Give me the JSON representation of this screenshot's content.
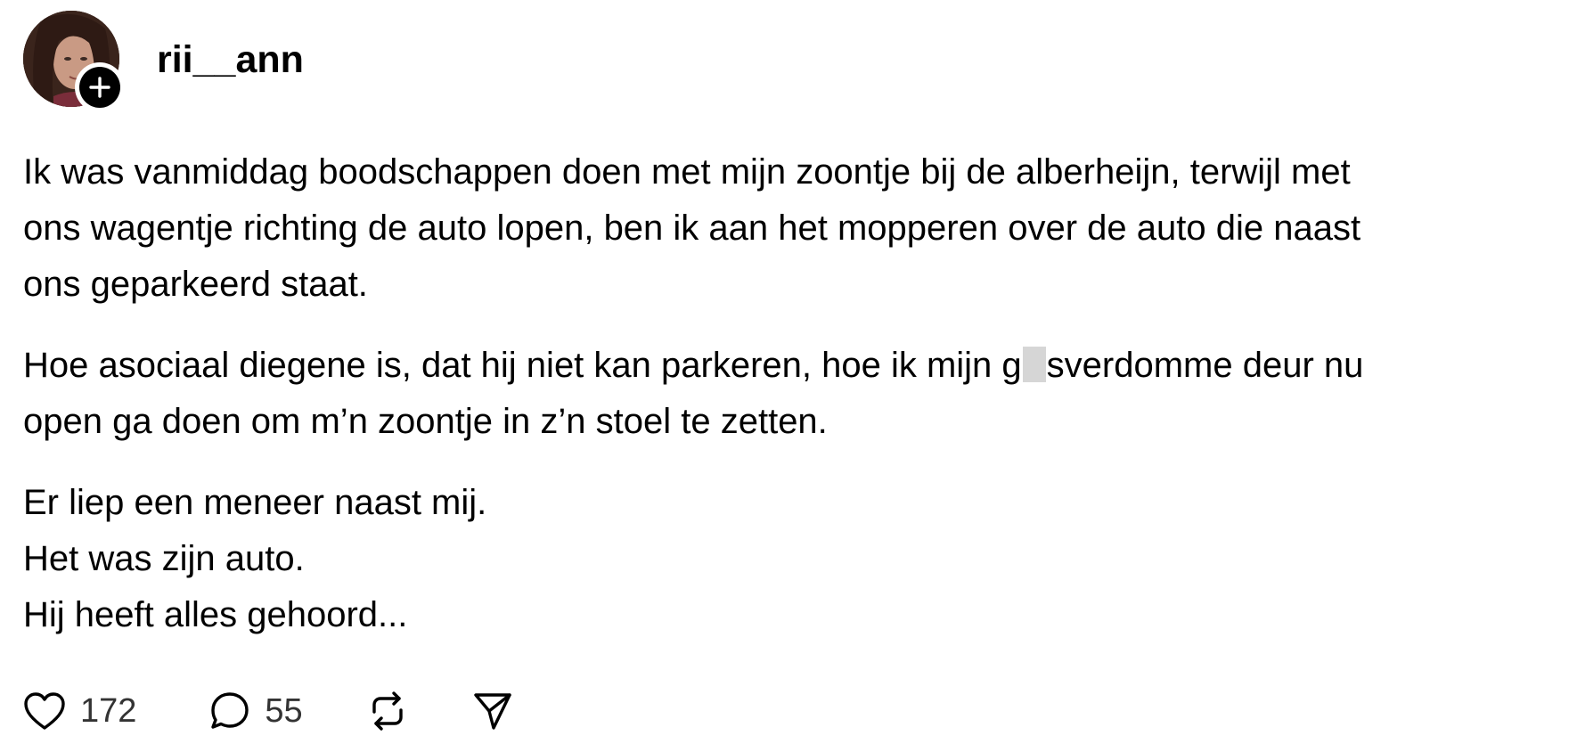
{
  "post": {
    "author": {
      "username": "rii__ann",
      "avatar_icon": "profile-photo",
      "follow_icon": "plus-icon"
    },
    "paragraphs": [
      {
        "text": "Ik was vanmiddag boodschappen doen met mijn zoontje bij de alberheijn, terwijl met\nons wagentje richting de auto lopen, ben ik aan het mopperen over de auto die naast\nons geparkeerd staat."
      },
      {
        "before_censor": "Hoe asociaal diegene is, dat hij niet kan parkeren, hoe ik mijn g",
        "after_censor": "sverdomme deur nu\nopen ga doen om m’n zoontje in z’n stoel te zetten."
      },
      {
        "text": "Er liep een meneer naast mij.\nHet was zijn auto.\nHij heeft alles gehoord..."
      }
    ],
    "actions": {
      "like": {
        "icon": "heart-icon",
        "count": "172"
      },
      "reply": {
        "icon": "comment-bubble-icon",
        "count": "55"
      },
      "repost": {
        "icon": "repost-icon"
      },
      "share": {
        "icon": "send-icon"
      }
    },
    "colors": {
      "text": "#000000",
      "count_text": "#333333",
      "censor_block": "#d6d6d6",
      "background": "#ffffff"
    }
  }
}
